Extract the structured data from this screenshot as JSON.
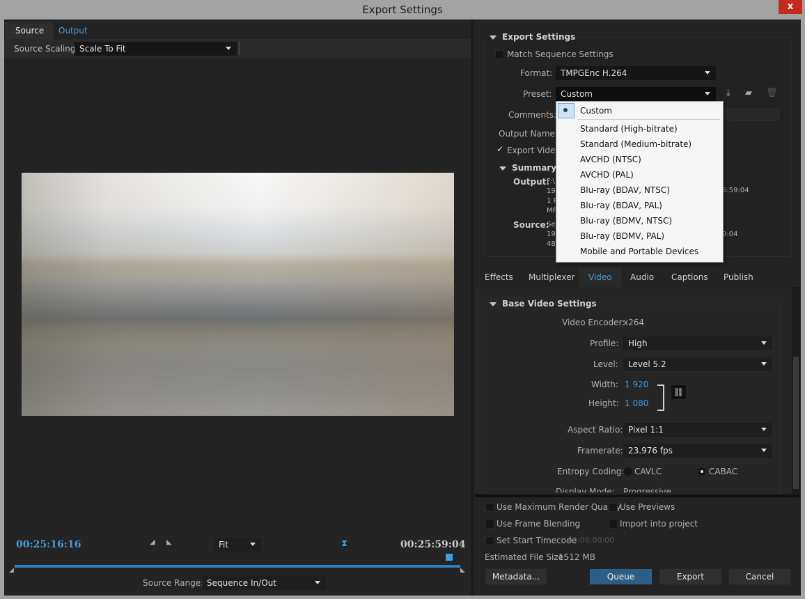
{
  "window": {
    "title": "Export Settings",
    "close": "x"
  },
  "left": {
    "tabs": [
      "Source",
      "Output"
    ],
    "source_scaling_label": "Source Scaling:",
    "source_scaling_value": "Scale To Fit",
    "timecode_in": "00:25:16:16",
    "timecode_out": "00:25:59:04",
    "zoom_value": "Fit",
    "source_range_label": "Source Range:",
    "source_range_value": "Sequence In/Out",
    "playhead_position": 0.97
  },
  "export_settings": {
    "heading": "Export Settings",
    "match_sequence": "Match Sequence Settings",
    "format_label": "Format:",
    "format_value": "TMPGEnc H.264",
    "preset_label": "Preset:",
    "preset_value": "Custom",
    "comments_label": "Comments:",
    "output_name_label": "Output Name:",
    "export_video": "Export Video",
    "summary_heading": "Summary",
    "output_label": "Output:",
    "output_lines": [
      "F:\\",
      "19",
      "1 P",
      "MP"
    ],
    "output_right": "5:59:04",
    "source_label": "Source:",
    "source_lines": [
      "Se",
      "19",
      "48"
    ],
    "source_right": "9:04"
  },
  "preset_menu": {
    "items": [
      "Custom",
      "Standard (High-bitrate)",
      "Standard (Medium-bitrate)",
      "AVCHD (NTSC)",
      "AVCHD (PAL)",
      "Blu-ray (BDAV, NTSC)",
      "Blu-ray (BDAV, PAL)",
      "Blu-ray (BDMV, NTSC)",
      "Blu-ray (BDMV, PAL)",
      "Mobile and Portable Devices"
    ],
    "selected": "Custom"
  },
  "tabs": [
    "Effects",
    "Multiplexer",
    "Video",
    "Audio",
    "Captions",
    "Publish"
  ],
  "active_tab": "Video",
  "video": {
    "heading": "Base Video Settings",
    "encoder_label": "Video Encoder:",
    "encoder_value": "x264",
    "profile_label": "Profile:",
    "profile_value": "High",
    "level_label": "Level:",
    "level_value": "Level 5.2",
    "width_label": "Width:",
    "width_value": "1 920",
    "height_label": "Height:",
    "height_value": "1 080",
    "aspect_label": "Aspect Ratio:",
    "aspect_value": "Pixel 1:1",
    "framerate_label": "Framerate:",
    "framerate_value": "23.976 fps",
    "entropy_label": "Entropy Coding:",
    "entropy_opt1": "CAVLC",
    "entropy_opt2": "CABAC",
    "display_mode_label": "Display Mode:",
    "display_mode_value": "Progressive"
  },
  "bottom": {
    "max_render": "Use Maximum Render Quality",
    "use_previews": "Use Previews",
    "frame_blending": "Use Frame Blending",
    "import_project": "Import into project",
    "start_timecode": "Set Start Timecode",
    "start_timecode_value": "00:00:00:00",
    "file_size_label": "Estimated File Size:",
    "file_size_value": "1512 MB",
    "metadata": "Metadata...",
    "queue": "Queue",
    "export": "Export",
    "cancel": "Cancel"
  },
  "colors": {
    "accent": "#3f9bd9",
    "primary_button": "#2d5f86",
    "close": "#c42b1c"
  }
}
